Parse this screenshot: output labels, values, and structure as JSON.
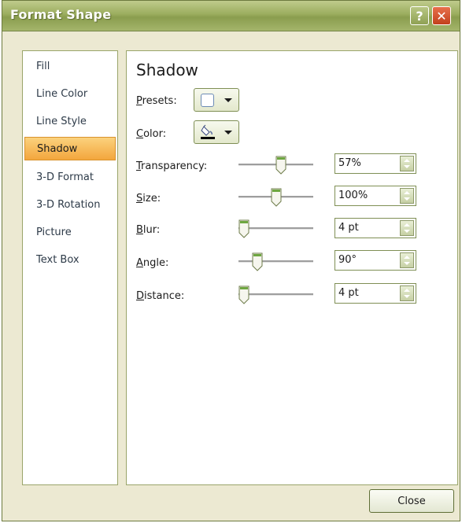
{
  "window": {
    "title": "Format Shape",
    "help_symbol": "?",
    "close_symbol": "✕"
  },
  "nav": {
    "items": [
      {
        "label": "Fill"
      },
      {
        "label": "Line Color"
      },
      {
        "label": "Line Style"
      },
      {
        "label": "Shadow",
        "selected": true
      },
      {
        "label": "3-D Format"
      },
      {
        "label": "3-D Rotation"
      },
      {
        "label": "Picture"
      },
      {
        "label": "Text Box"
      }
    ]
  },
  "panel": {
    "heading": "Shadow",
    "presets": {
      "key": "P",
      "rest": "resets:",
      "icon": "shadow-preset-icon"
    },
    "color": {
      "key": "C",
      "rest": "olor:",
      "icon": "paint-bucket-icon"
    },
    "rows": [
      {
        "key": "T",
        "rest": "ransparency:",
        "value": "57%",
        "level": 0.57
      },
      {
        "key": "S",
        "rest": "ize:",
        "value": "100%",
        "level": 0.5
      },
      {
        "key": "B",
        "rest": "lur:",
        "value": "4 pt",
        "level": 0.04
      },
      {
        "key": "A",
        "rest": "ngle:",
        "value": "90°",
        "level": 0.25
      },
      {
        "key": "D",
        "rest": "istance:",
        "value": "4 pt",
        "level": 0.02
      }
    ]
  },
  "footer": {
    "close_label": "Close"
  },
  "colors": {
    "title_green": "#9bad5e",
    "selected_orange": "#f3a63d",
    "thumb_green": "#6ea741"
  }
}
